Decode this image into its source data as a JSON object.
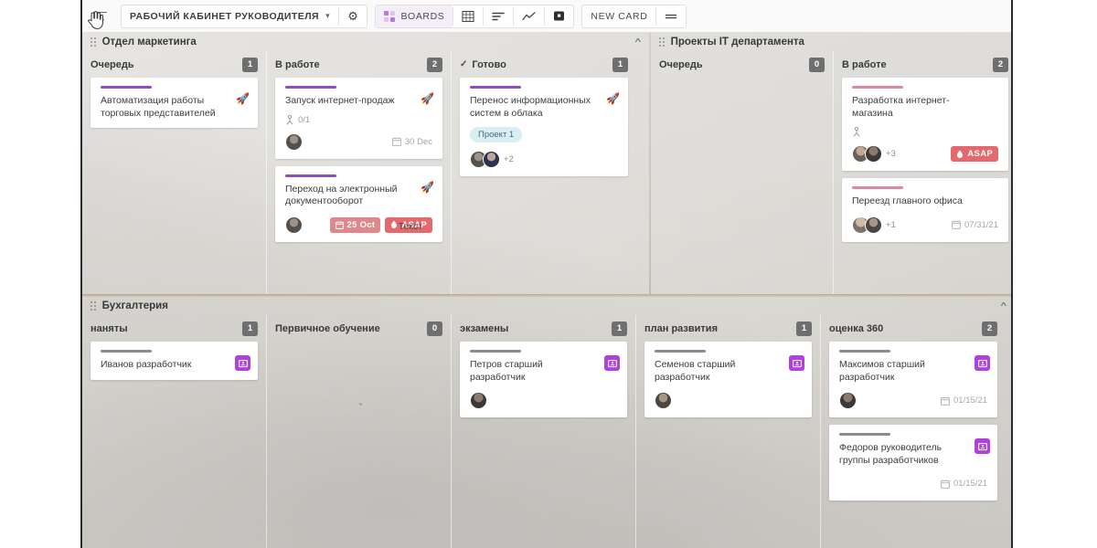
{
  "toolbar": {
    "menu_icon": "hamburger-menu-icon",
    "cursor_icon": "pointer-hand-cursor",
    "workspace_name": "РАБОЧИЙ КАБИНЕТ РУКОВОДИТЕЛЯ",
    "workspace_chevron": "▾",
    "settings_icon": "gear-icon",
    "views": [
      {
        "id": "boards",
        "label": "BOARDS",
        "icon": "boards-grid-icon",
        "active": true
      },
      {
        "id": "table",
        "label": "",
        "icon": "table-grid-icon",
        "active": false
      },
      {
        "id": "list",
        "label": "",
        "icon": "list-icon",
        "active": false
      },
      {
        "id": "chart",
        "label": "",
        "icon": "trend-chart-icon",
        "active": false
      },
      {
        "id": "square",
        "label": "",
        "icon": "filled-square-icon",
        "active": false
      }
    ],
    "new_card_label": "NEW CARD",
    "more_icon": "equals-menu-icon"
  },
  "colors": {
    "accent_purple": "#8b4fbf",
    "accent_pink": "#d98aa0",
    "accent_gray": "#8c8c8c",
    "badge_count": "#6f6f6f",
    "pill_date": "#e0878a",
    "pill_asap": "#e4696e",
    "tag_blue": "#d9edf4",
    "person_badge": "#b23fe0"
  },
  "boards": [
    {
      "id": "marketing",
      "title": "Отдел маркетинга",
      "collapse_icon": "chevron-up-icon",
      "grip_icon": "drag-grip-icon",
      "columns": [
        {
          "title": "Очередь",
          "count": "1",
          "check": false,
          "cards": [
            {
              "title": "Автоматизация работы торговых представителей",
              "accent": "purple",
              "rocket": "🚀",
              "subtask": null,
              "tag": null,
              "avatars": [],
              "avatar_more": null,
              "due": null,
              "pills": []
            }
          ]
        },
        {
          "title": "В работе",
          "count": "2",
          "check": false,
          "cards": [
            {
              "title": "Запуск интернет-продаж",
              "accent": "purple",
              "rocket": "🚀",
              "subtask": "0/1",
              "tag": null,
              "avatars": [
                "a1"
              ],
              "avatar_more": null,
              "due": "30 Dec",
              "pills": []
            },
            {
              "title": "Переход на электронный документооборот",
              "accent": "purple",
              "rocket": "🚀",
              "subtask": null,
              "tag": null,
              "avatars": [
                "a1"
              ],
              "avatar_more": null,
              "due": null,
              "pills": [
                {
                  "kind": "date",
                  "label": "25 Oct",
                  "icon": "calendar-icon"
                },
                {
                  "kind": "asap",
                  "label": "ASAP",
                  "icon": "flame-icon"
                }
              ],
              "overlap_text": "Текст"
            }
          ]
        },
        {
          "title": "Готово",
          "count": "1",
          "check": true,
          "check_icon": "checkmark-icon",
          "cards": [
            {
              "title": "Перенос информационных систем в облака",
              "accent": "purple",
              "rocket": "🚀",
              "subtask": null,
              "tag": "Проект 1",
              "avatars": [
                "a1",
                "a2"
              ],
              "avatar_more": "+2",
              "due": null,
              "pills": []
            }
          ]
        }
      ]
    },
    {
      "id": "it-projects",
      "title": "Проекты IT департамента",
      "collapse_icon": "chevron-up-icon",
      "grip_icon": "drag-grip-icon",
      "columns": [
        {
          "title": "Очередь",
          "count": "0",
          "check": false,
          "cards": []
        },
        {
          "title": "В работе",
          "count": "2",
          "check": false,
          "cards": [
            {
              "title": "Разработка интернет-магазина",
              "accent": "pink",
              "rocket": null,
              "subtask": "",
              "subtask_icon_only": true,
              "tag": null,
              "avatars": [
                "a3",
                "a4"
              ],
              "avatar_more": "+3",
              "due": null,
              "pills": [
                {
                  "kind": "asap",
                  "label": "ASAP",
                  "icon": "flame-icon"
                }
              ]
            },
            {
              "title": "Переезд главного офиса",
              "accent": "pink",
              "rocket": null,
              "subtask": null,
              "tag": null,
              "avatars": [
                "a5",
                "a6"
              ],
              "avatar_more": "+1",
              "due": "07/31/21",
              "pills": []
            }
          ]
        }
      ]
    },
    {
      "id": "accounting",
      "title": "Бухгалтерия",
      "collapse_icon": "chevron-up-icon",
      "grip_icon": "drag-grip-icon",
      "columns": [
        {
          "title": "наняты",
          "count": "1",
          "check": false,
          "cards": [
            {
              "title": "Иванов разработчик",
              "accent": "gray",
              "person_badge": "person-badge-icon",
              "avatars": [],
              "due": null
            }
          ]
        },
        {
          "title": "Первичное обучение",
          "count": "0",
          "check": false,
          "cards": []
        },
        {
          "title": "экзамены",
          "count": "1",
          "check": false,
          "cards": [
            {
              "title": "Петров старший разработчик",
              "accent": "gray",
              "person_badge": "person-badge-icon",
              "avatars": [
                "a4"
              ],
              "due": null
            }
          ]
        },
        {
          "title": "план развития",
          "count": "1",
          "check": false,
          "cards": [
            {
              "title": "Семенов старший разработчик",
              "accent": "gray",
              "person_badge": "person-badge-icon",
              "avatars": [
                "a6"
              ],
              "due": null
            }
          ]
        },
        {
          "title": "оценка 360",
          "count": "2",
          "check": false,
          "cards": [
            {
              "title": "Максимов старший разработчик",
              "accent": "gray",
              "person_badge": "person-badge-icon",
              "avatars": [
                "a4"
              ],
              "due": "01/15/21"
            },
            {
              "title": "Федоров руководитель группы разработчиков",
              "accent": "gray",
              "person_badge": "person-badge-icon",
              "avatars": [],
              "due": "01/15/21"
            }
          ]
        }
      ]
    }
  ]
}
